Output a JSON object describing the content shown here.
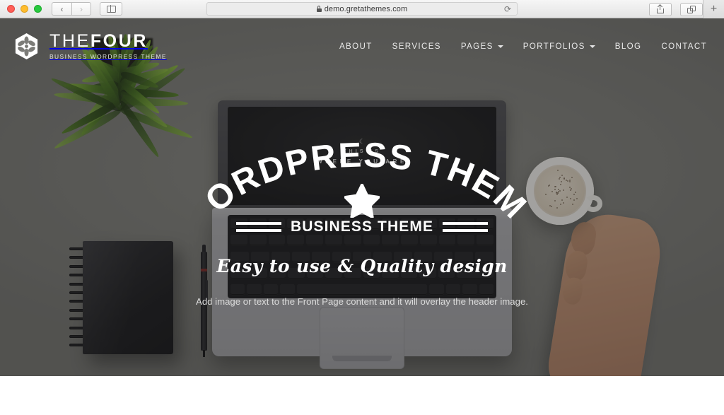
{
  "browser": {
    "traffic_lights": [
      "close",
      "minimize",
      "maximize"
    ],
    "back_label": "‹",
    "forward_label": "›",
    "sidebar_icon": "sidebar-icon",
    "url": "demo.gretathemes.com",
    "lock_icon": "lock-icon",
    "reload_label": "⟳",
    "share_icon": "share-icon",
    "tabs_icon": "tabs-overview-icon",
    "new_tab_label": "+"
  },
  "site": {
    "brand": {
      "mark_icon": "flower-hexagon-logo-icon",
      "title_light": "THE",
      "title_bold": "FOUR",
      "tagline": "BUSINESS WORDPRESS THEME"
    },
    "nav": [
      {
        "label": "ABOUT",
        "has_dropdown": false
      },
      {
        "label": "SERVICES",
        "has_dropdown": false
      },
      {
        "label": "PAGES",
        "has_dropdown": true
      },
      {
        "label": "PORTFOLIOS",
        "has_dropdown": true
      },
      {
        "label": "BLOG",
        "has_dropdown": false
      },
      {
        "label": "CONTACT",
        "has_dropdown": false
      }
    ]
  },
  "hero": {
    "arc_title": "WORDPRESS THEME",
    "star_icon": "star-icon",
    "band_text": "BUSINESS THEME",
    "script_text": "Easy to use  &  Quality design",
    "overlay_note": "Add image or text to the Front Page content and it will overlay the header image.",
    "laptop_screen": {
      "moon_icon": "moon-icon",
      "line1": "THIS IS",
      "line2": "WHERE YOU ARE"
    }
  },
  "colors": {
    "hero_bg": "#787874",
    "hero_tint": "rgba(40,40,40,0.40)",
    "text_on_hero": "#ffffff",
    "note_text": "#dcdcdc",
    "chrome_bg": "#eeeeee",
    "content_bg": "#ffffff"
  }
}
